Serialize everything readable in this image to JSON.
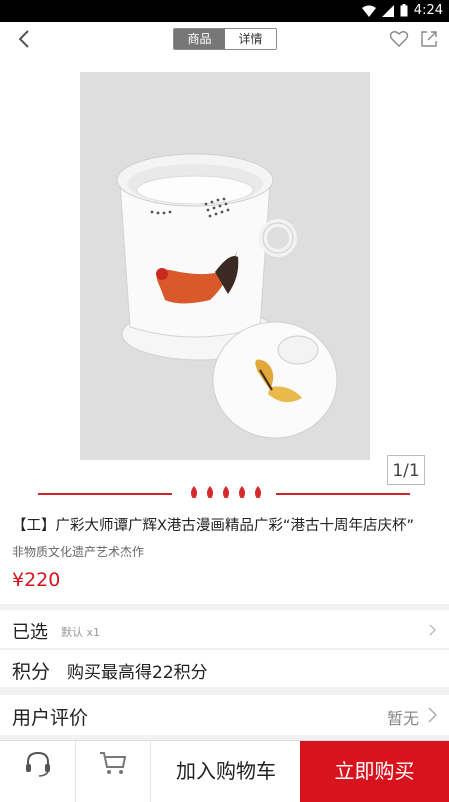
{
  "status_bar": {
    "time": "4:24"
  },
  "nav": {
    "tabs": [
      "商品",
      "详情"
    ],
    "active_tab": 0
  },
  "gallery": {
    "counter": "1/1"
  },
  "product": {
    "title": "【工】广彩大师谭广辉X港古漫画精品广彩“港古十周年店庆杯”",
    "subtitle": "非物质文化遗产艺术杰作",
    "price": "¥220"
  },
  "selected": {
    "label": "已选",
    "value": "默认 x1"
  },
  "points": {
    "label": "积分",
    "value": "购买最高得22积分"
  },
  "reviews": {
    "label": "用户评价",
    "value": "暂无"
  },
  "bottom_bar": {
    "add_to_cart": "加入购物车",
    "buy_now": "立即购买"
  },
  "colors": {
    "accent": "#d7141e",
    "divider": "#c9252b"
  }
}
